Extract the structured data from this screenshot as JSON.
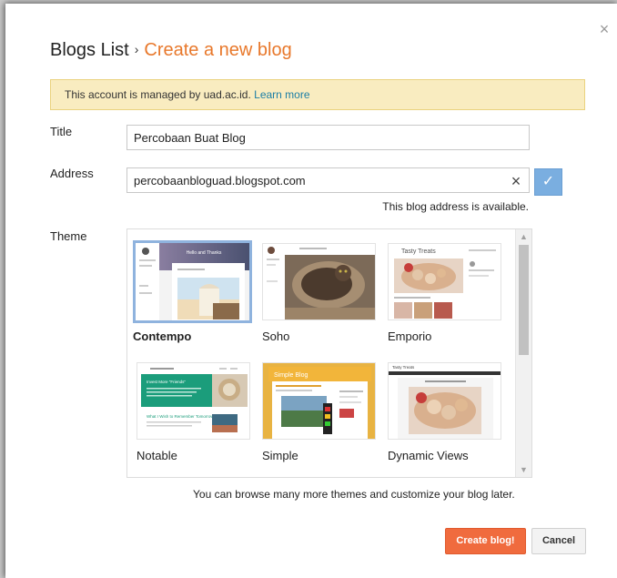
{
  "header": {
    "breadcrumb_root": "Blogs List",
    "separator": "›",
    "current": "Create a new blog",
    "close_symbol": "×"
  },
  "notice": {
    "text": "This account is managed by uad.ac.id.",
    "link": "Learn more"
  },
  "form": {
    "title_label": "Title",
    "title_value": "Percobaan Buat Blog",
    "address_label": "Address",
    "address_value": "percobaanbloguad.blogspot.com",
    "clear_symbol": "×",
    "check_symbol": "✓",
    "availability": "This blog address is available.",
    "theme_label": "Theme"
  },
  "themes": [
    {
      "name": "Contempo",
      "selected": true,
      "icon": "contempo-thumbnail"
    },
    {
      "name": "Soho",
      "selected": false,
      "icon": "soho-thumbnail"
    },
    {
      "name": "Emporio",
      "selected": false,
      "icon": "emporio-thumbnail"
    },
    {
      "name": "Notable",
      "selected": false,
      "icon": "notable-thumbnail"
    },
    {
      "name": "Simple",
      "selected": false,
      "icon": "simple-thumbnail"
    },
    {
      "name": "Dynamic Views",
      "selected": false,
      "icon": "dynamic-views-thumbnail"
    }
  ],
  "theme_thumbnails": {
    "contempo_title": "Hello and Thanks",
    "emporio_title": "Tasty Treats",
    "notable_title": "Invest More \"Friends\"",
    "notable_subtitle": "What I Wish to Remember Tomorrow?",
    "simple_title": "Simple Blog",
    "dynamic_title": "Tasty Treats"
  },
  "browse_note": "You can browse many more themes and customize your blog later.",
  "buttons": {
    "create": "Create blog!",
    "cancel": "Cancel"
  },
  "colors": {
    "accent_orange": "#e8782b",
    "notice_bg": "#f9ecc0",
    "create_button": "#f06b3e",
    "check_button": "#7aaee0",
    "link": "#1c7ea5"
  }
}
